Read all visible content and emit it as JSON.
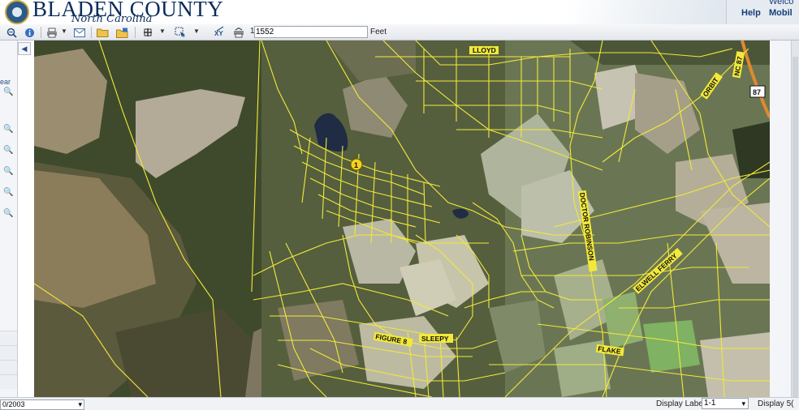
{
  "header": {
    "county_name": "BLADEN COUNTY",
    "state_name": "North Carolina",
    "welcome_text": "Welco",
    "help_label": "Help",
    "mobile_label": "Mobil"
  },
  "toolbar": {
    "scale_prefix": "1:",
    "scale_value": "1552",
    "scale_unit": "Feet",
    "icons": [
      "zoom-out-icon",
      "info-icon",
      "print-icon",
      "email-icon",
      "folder-open-icon",
      "folder-save-icon",
      "measure-icon",
      "select-tool-icon",
      "xy-coordinate-icon",
      "print-map-icon"
    ],
    "xy_label": "XY"
  },
  "left_panel": {
    "clear_label": "ear",
    "date_select_value": "0/2003"
  },
  "map": {
    "road_labels": [
      "LLOYD",
      "ORBIT",
      "NC 87",
      "87",
      "DOCTOR ROBINSON",
      "ELWELL FERRY",
      "FIGURE 8",
      "SLEEPY",
      "FLAKE"
    ],
    "marker_label": "1"
  },
  "bottom": {
    "display_labels_label": "Display Labels",
    "display_labels_value": "1-1",
    "display_2_label": "Display 5("
  },
  "colors": {
    "parcel_line": "#f2e93a",
    "header_blue": "#0b2c5a",
    "link_blue": "#173c7a"
  }
}
